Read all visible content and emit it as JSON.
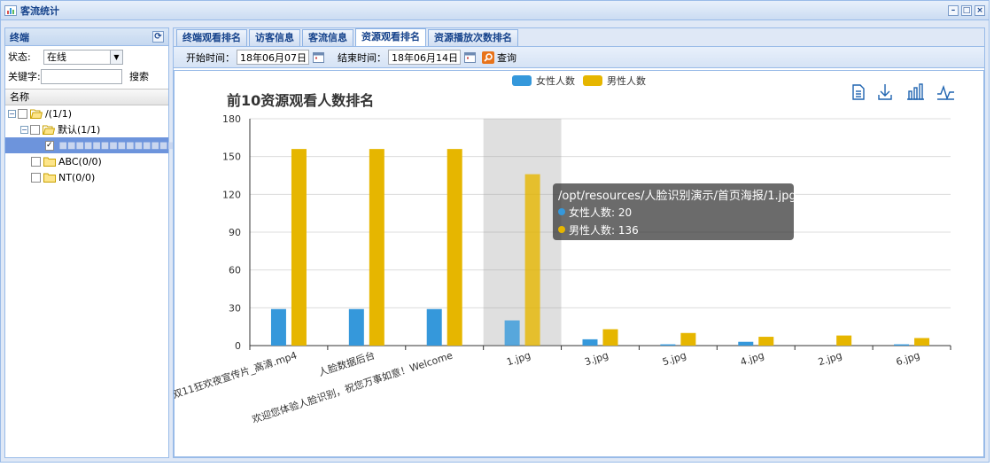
{
  "window": {
    "title": "客流统计",
    "min": "–",
    "max": "□",
    "close": "×"
  },
  "left": {
    "header": "终端",
    "refresh": "⟳",
    "status_label": "状态:",
    "status_value": "在线",
    "keyword_label": "关键字:",
    "keyword_value": "",
    "search_label": "搜索",
    "tree_header": "名称",
    "tree": [
      {
        "label": "/(1/1)"
      },
      {
        "label": "默认(1/1)"
      },
      {
        "label": "■■■■■■■■■■■■■■"
      },
      {
        "label": "ABC(0/0)"
      },
      {
        "label": "NT(0/0)"
      }
    ]
  },
  "tabs": [
    "终端观看排名",
    "访客信息",
    "客流信息",
    "资源观看排名",
    "资源播放次数排名"
  ],
  "toolbar": {
    "start_label": "开始时间：",
    "start_value": "18年06月07日",
    "end_label": "结束时间：",
    "end_value": "18年06月14日",
    "query_label": "查询"
  },
  "chart_data": {
    "type": "bar",
    "title": "前10资源观看人数排名",
    "ylim": [
      0,
      180
    ],
    "yticks": [
      0,
      30,
      60,
      90,
      120,
      150,
      180
    ],
    "categories": [
      "双11狂欢夜宣传片_高清.mp4",
      "人脸数据后台",
      "欢迎您体验人脸识别，祝您万事如意！Welcome",
      "1.jpg",
      "3.jpg",
      "5.jpg",
      "4.jpg",
      "2.jpg",
      "6.jpg"
    ],
    "series": [
      {
        "name": "女性人数",
        "color": "#3598db",
        "values": [
          29,
          29,
          29,
          20,
          5,
          1,
          3,
          0,
          1
        ]
      },
      {
        "name": "男性人数",
        "color": "#e6b600",
        "values": [
          156,
          156,
          156,
          136,
          13,
          10,
          7,
          8,
          6
        ]
      }
    ],
    "highlight_index": 3,
    "tooltip": {
      "title": "/opt/resources/人脸识别演示/首页海报/1.jpg",
      "rows": [
        "女性人数: 20",
        "男性人数: 136"
      ]
    },
    "toolbox": [
      "data-view-icon",
      "download-icon",
      "bar-switch-icon",
      "line-switch-icon"
    ]
  }
}
